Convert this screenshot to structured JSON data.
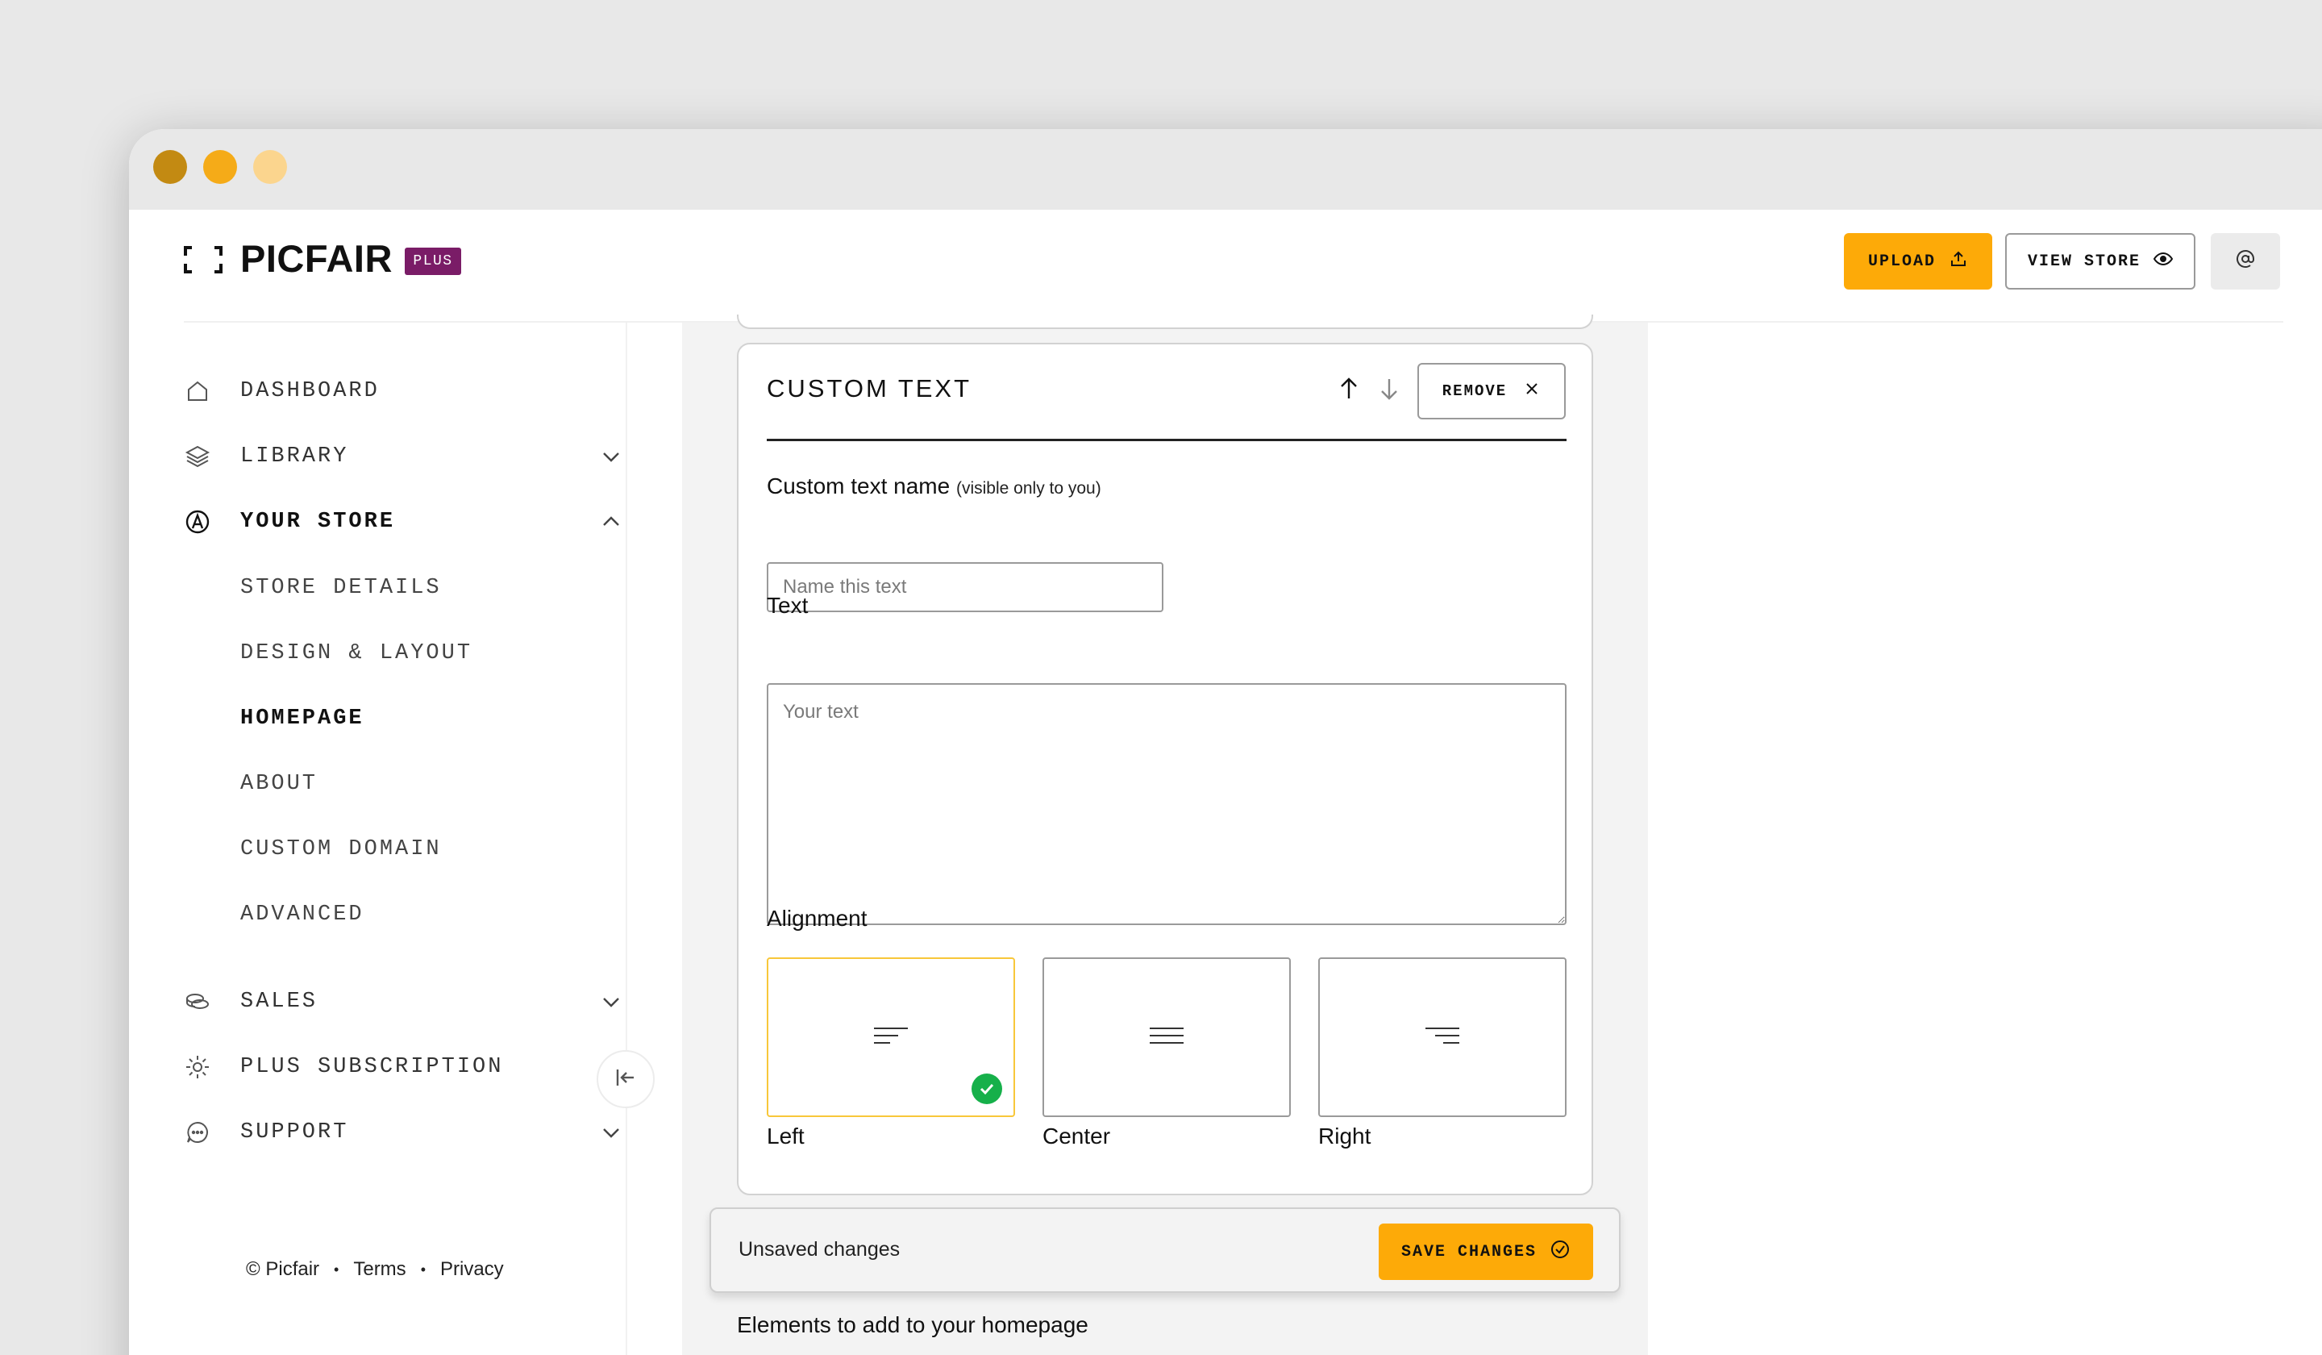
{
  "app": {
    "logo_text": "PICFAIR",
    "plus_badge": "PLUS",
    "accent_color": "#fdaa08",
    "badge_color": "#7a1c67"
  },
  "header": {
    "upload_label": "UPLOAD",
    "view_store_label": "VIEW STORE",
    "account_icon": "at-sign-icon"
  },
  "sidebar": {
    "items": [
      {
        "label": "DASHBOARD",
        "icon": "home-icon"
      },
      {
        "label": "LIBRARY",
        "icon": "layers-icon"
      },
      {
        "label": "YOUR STORE",
        "icon": "store-icon"
      },
      {
        "label": "SALES",
        "icon": "coins-icon"
      },
      {
        "label": "PLUS SUBSCRIPTION",
        "icon": "gear-icon"
      },
      {
        "label": "SUPPORT",
        "icon": "chat-icon"
      }
    ],
    "store_subitems": [
      {
        "label": "STORE DETAILS"
      },
      {
        "label": "DESIGN & LAYOUT"
      },
      {
        "label": "HOMEPAGE",
        "active": true
      },
      {
        "label": "ABOUT"
      },
      {
        "label": "CUSTOM DOMAIN"
      },
      {
        "label": "ADVANCED"
      }
    ],
    "footer": {
      "copyright": "© Picfair",
      "terms": "Terms",
      "privacy": "Privacy",
      "separator": "•"
    }
  },
  "card": {
    "title": "CUSTOM TEXT",
    "remove_label": "REMOVE",
    "name_label": "Custom text name",
    "name_hint": "(visible only to you)",
    "name_placeholder": "Name this text",
    "name_value": "",
    "text_label": "Text",
    "text_placeholder": "Your text",
    "text_value": "",
    "alignment_label": "Alignment",
    "alignment_options": [
      {
        "label": "Left",
        "selected": true
      },
      {
        "label": "Center",
        "selected": false
      },
      {
        "label": "Right",
        "selected": false
      }
    ]
  },
  "savebar": {
    "status": "Unsaved changes",
    "save_label": "SAVE CHANGES"
  },
  "elements_heading": "Elements to add to your homepage"
}
